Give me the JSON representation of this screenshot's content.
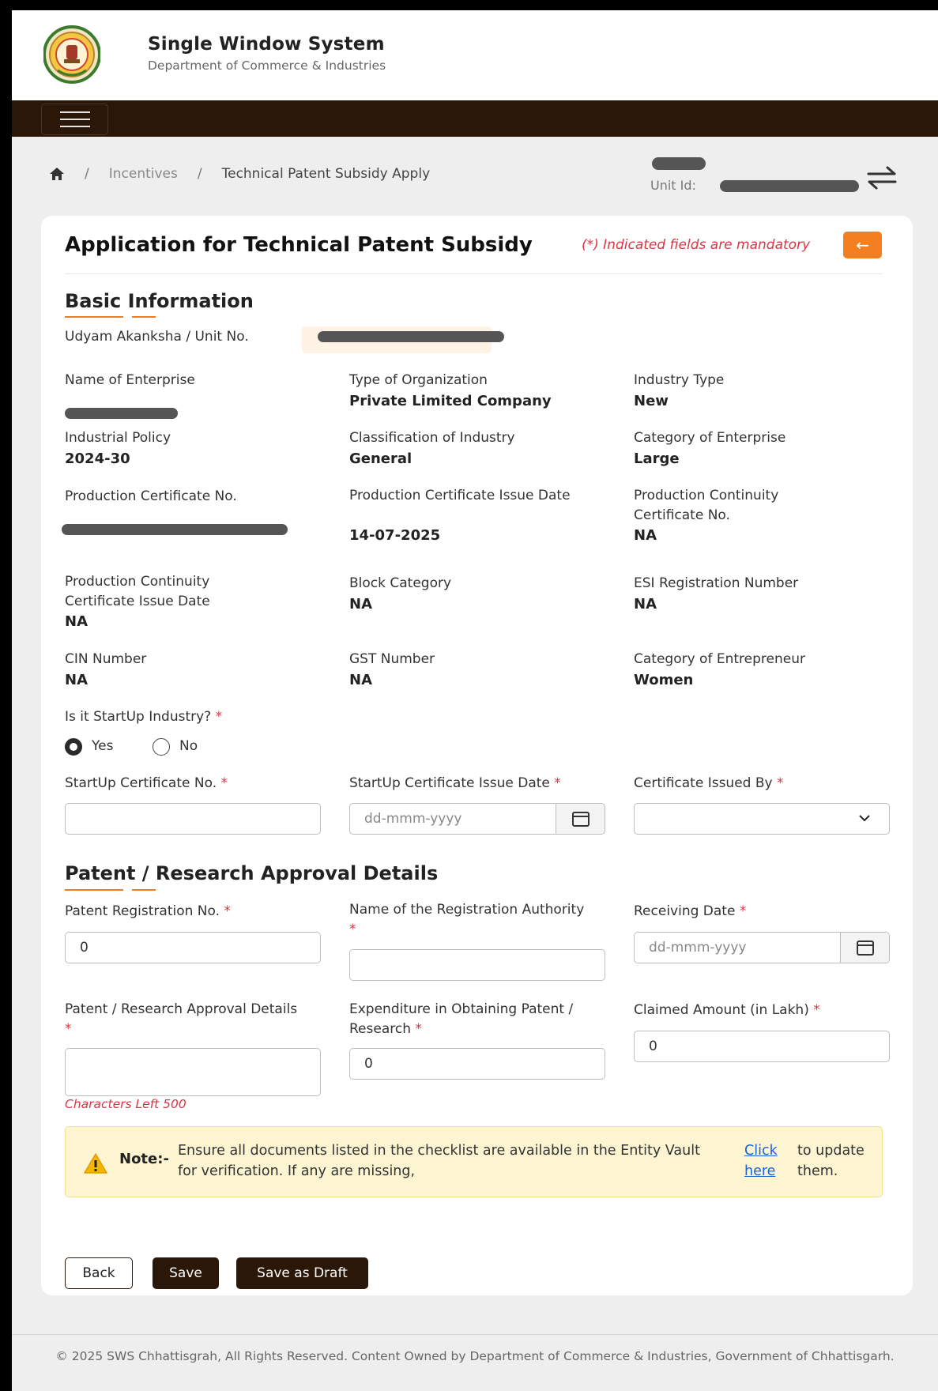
{
  "header": {
    "title": "Single Window System",
    "subtitle": "Department of Commerce & Industries"
  },
  "breadcrumb": {
    "items": [
      "Incentives",
      "Technical Patent Subsidy Apply"
    ],
    "separator": "/"
  },
  "unit": {
    "label": "Unit Id:"
  },
  "form": {
    "title": "Application for Technical Patent Subsidy",
    "mandatory_note": "(*) Indicated fields are mandatory",
    "back_arrow": "←",
    "basic_info": {
      "title": "Basic Information",
      "udyam_label": "Udyam Akanksha / Unit No.",
      "fields": [
        {
          "label": "Name of Enterprise",
          "value": ""
        },
        {
          "label": "Type of Organization",
          "value": "Private Limited Company"
        },
        {
          "label": "Industry Type",
          "value": "New"
        },
        {
          "label": "Industrial Policy",
          "value": "2024-30"
        },
        {
          "label": "Classification of Industry",
          "value": "General"
        },
        {
          "label": "Category of Enterprise",
          "value": "Large"
        },
        {
          "label": "Production Certificate No.",
          "value": ""
        },
        {
          "label": "Production Certificate Issue Date",
          "value": "14-07-2025"
        },
        {
          "label": "Production Continuity Certificate No.",
          "value": "NA"
        },
        {
          "label": "Production Continuity Certificate Issue Date",
          "value": "NA"
        },
        {
          "label": "Block Category",
          "value": "NA"
        },
        {
          "label": "ESI Registration Number",
          "value": "NA"
        },
        {
          "label": "CIN Number",
          "value": "NA"
        },
        {
          "label": "GST Number",
          "value": "NA"
        },
        {
          "label": "Category of Entrepreneur",
          "value": "Women"
        }
      ],
      "startup_question": "Is it StartUp Industry?",
      "startup_options": [
        "Yes",
        "No"
      ],
      "startup_selected": "Yes",
      "startup_cert_no_label": "StartUp Certificate No.",
      "startup_cert_no_value": "",
      "startup_cert_date_label": "StartUp Certificate Issue Date",
      "startup_cert_date_placeholder": "dd-mmm-yyyy",
      "cert_issued_by_label": "Certificate Issued By",
      "cert_issued_by_value": ""
    },
    "patent": {
      "title": "Patent / Research Approval Details",
      "reg_no_label": "Patent Registration No.",
      "reg_no_value": "0",
      "authority_label": "Name of the Registration Authority",
      "authority_value": "",
      "receiving_date_label": "Receiving Date",
      "receiving_date_placeholder": "dd-mmm-yyyy",
      "approval_details_label": "Patent / Research Approval Details",
      "approval_details_value": "",
      "chars_left": "Characters Left 500",
      "expenditure_label": "Expenditure in Obtaining Patent / Research",
      "expenditure_value": "0",
      "claimed_label": "Claimed Amount (in Lakh)",
      "claimed_value": "0"
    },
    "note": {
      "label": "Note:-",
      "text": "Ensure all documents listed in the checklist are available in the Entity Vault for verification. If any are missing,",
      "link": "Click here",
      "after": "to update them."
    },
    "buttons": {
      "back": "Back",
      "save": "Save",
      "draft": "Save as Draft"
    }
  },
  "footer": "© 2025 SWS Chhattisgrah, All Rights Reserved. Content Owned by Department of Commerce & Industries, Government of Chhattisgarh.",
  "colors": {
    "nav": "#2b1708",
    "accent": "#f47f20",
    "danger": "#dc3545",
    "link": "#1a63d8"
  }
}
